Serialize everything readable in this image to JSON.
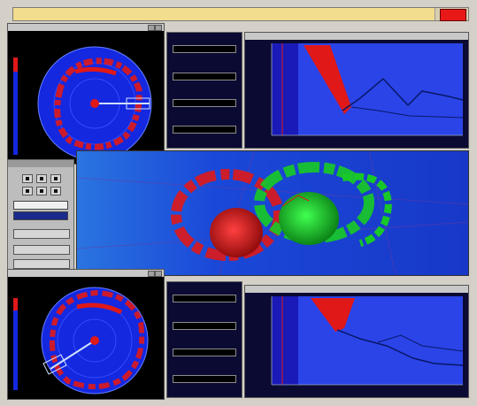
{
  "app": {
    "menu": [
      {
        "label": ""
      },
      {
        "label": ""
      },
      {
        "label": ""
      },
      {
        "label": ""
      },
      {
        "label": ""
      },
      {
        "label": ""
      },
      {
        "label": ""
      },
      {
        "label": ""
      },
      {
        "label": ""
      },
      {
        "label": ""
      }
    ],
    "alarm_color": "#e81818"
  },
  "colors": {
    "radar_sea": "#1428e0",
    "echo": "#e01818",
    "echo_secondary": "#18c828",
    "panel": "#0a0a32",
    "chrome": "#d4d0c8"
  },
  "radar_top": {
    "title": "",
    "sweep_color": "#9fb6ff",
    "icons": [
      "radar-sweep-icon",
      "zoom-box-icon"
    ]
  },
  "radar_bottom": {
    "title": "",
    "sweep_color": "#9fb6ff",
    "icons": [
      "radar-sweep-icon",
      "zoom-box-icon"
    ]
  },
  "info_top": {
    "title": "",
    "fields": [
      {
        "label": "",
        "value": ""
      },
      {
        "label": "",
        "value": ""
      },
      {
        "label": "",
        "value": ""
      },
      {
        "label": "",
        "value": ""
      }
    ]
  },
  "info_bottom": {
    "title": "",
    "fields": [
      {
        "label": "",
        "value": ""
      },
      {
        "label": "",
        "value": ""
      },
      {
        "label": "",
        "value": ""
      },
      {
        "label": "",
        "value": ""
      }
    ]
  },
  "plot_top": {
    "title": "",
    "y_ticks": [
      "",
      "",
      "",
      "",
      ""
    ],
    "x_ticks": [
      "",
      "",
      "",
      "",
      "",
      "",
      "",
      ""
    ]
  },
  "plot_bottom": {
    "title": "",
    "y_ticks": [
      "",
      "",
      "",
      "",
      ""
    ],
    "x_ticks": [
      "",
      "",
      "",
      "",
      "",
      "",
      "",
      ""
    ]
  },
  "control": {
    "title": "",
    "field_1": "",
    "field_2": "",
    "button_1": "",
    "button_2": "",
    "button_3": ""
  },
  "view3d": {
    "annotation": ""
  }
}
